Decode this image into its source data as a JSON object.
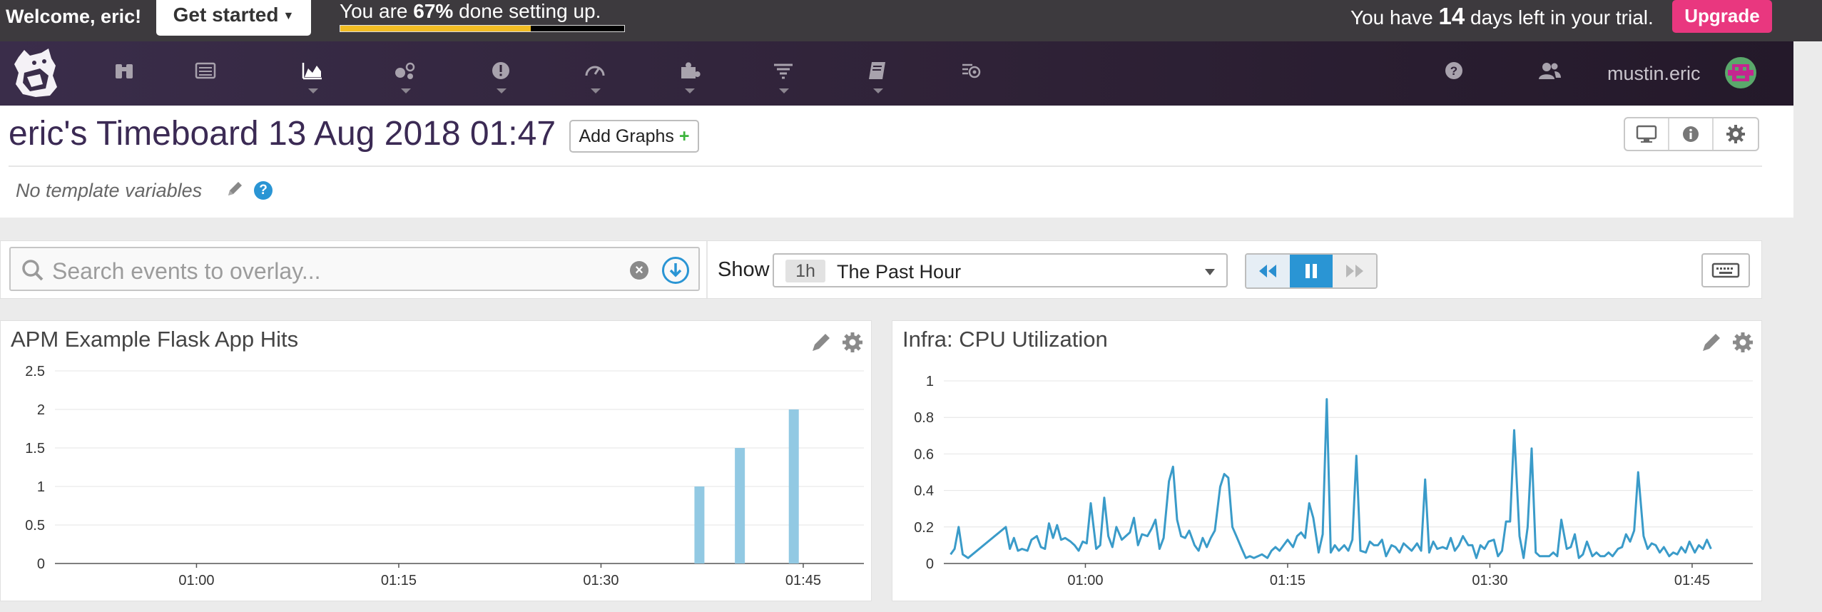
{
  "onboarding": {
    "welcome": "Welcome, eric!",
    "get_started": "Get started",
    "progress_prefix": "You are",
    "progress_percent": "67%",
    "progress_suffix": "done setting up.",
    "progress_value": 0.67,
    "trial_prefix": "You have",
    "trial_days": "14",
    "trial_suffix": "days left in your trial.",
    "upgrade": "Upgrade"
  },
  "nav": {
    "items": [
      {
        "icon": "binoculars-icon"
      },
      {
        "icon": "list-icon"
      },
      {
        "icon": "area-chart-icon",
        "active": true
      },
      {
        "icon": "hexagons-icon"
      },
      {
        "icon": "alert-icon"
      },
      {
        "icon": "gauge-icon"
      },
      {
        "icon": "puzzle-icon"
      },
      {
        "icon": "filter-icon"
      },
      {
        "icon": "notebook-icon"
      },
      {
        "icon": "synthetic-icon"
      }
    ],
    "username": "mustin.eric"
  },
  "board": {
    "title": "eric's Timeboard 13 Aug 2018 01:47",
    "add_graphs": "Add Graphs",
    "add_graphs_plus": "+",
    "template_vars": "No template variables",
    "help_glyph": "?"
  },
  "controls": {
    "search_placeholder": "Search events to overlay...",
    "show_label": "Show",
    "time_badge": "1h",
    "time_text": "The Past Hour"
  },
  "colors": {
    "accent": "#2a95d4",
    "upgrade": "#e9377f",
    "progress": "#f2bd23",
    "bar": "#92c9e3",
    "line": "#3a9bc9"
  },
  "chart_data": [
    {
      "type": "bar",
      "title": "APM Example Flask App Hits",
      "x_ticks": [
        "01:00",
        "01:15",
        "01:30",
        "01:45"
      ],
      "x_tick_minutes": [
        0,
        15,
        30,
        45
      ],
      "xlim_minutes": [
        -10.5,
        49.5
      ],
      "y_ticks": [
        "0",
        "0.5",
        "1",
        "1.5",
        "2",
        "2.5"
      ],
      "ylim": [
        0,
        2.5
      ],
      "bars": [
        {
          "x_minute": 37.3,
          "value": 1
        },
        {
          "x_minute": 40.3,
          "value": 1.5
        },
        {
          "x_minute": 44.3,
          "value": 2
        }
      ]
    },
    {
      "type": "line",
      "title": "Infra: CPU Utilization",
      "x_ticks": [
        "01:00",
        "01:15",
        "01:30",
        "01:45"
      ],
      "x_tick_minutes": [
        0,
        15,
        30,
        45
      ],
      "xlim_minutes": [
        -10.5,
        49.5
      ],
      "y_ticks": [
        "0",
        "0.2",
        "0.4",
        "0.6",
        "0.8",
        "1"
      ],
      "ylim": [
        0,
        1
      ],
      "series": [
        {
          "x_minutes": [
            -10.0,
            -9.7,
            -9.4,
            -9.1,
            -8.7,
            -5.9,
            -5.6,
            -5.3,
            -5.0,
            -4.7,
            -4.3,
            -4.0,
            -3.6,
            -3.3,
            -3.0,
            -2.7,
            -2.4,
            -2.1,
            -1.8,
            -1.5,
            -1.1,
            -0.8,
            -0.5,
            -0.2,
            0.1,
            0.4,
            0.8,
            1.1,
            1.4,
            1.7,
            2.0,
            2.3,
            2.7,
            3.0,
            3.3,
            3.6,
            3.9,
            4.2,
            4.6,
            4.9,
            5.2,
            5.5,
            5.8,
            6.2,
            6.5,
            6.8,
            7.1,
            7.4,
            7.7,
            8.1,
            8.4,
            8.7,
            9.0,
            9.3,
            9.6,
            10.0,
            10.3,
            10.6,
            10.9,
            11.2,
            11.6,
            11.9,
            12.2,
            12.5,
            12.8,
            13.1,
            13.5,
            13.8,
            14.1,
            14.4,
            14.7,
            15.0,
            15.4,
            15.7,
            16.0,
            16.3,
            16.6,
            16.9,
            17.3,
            17.6,
            17.9,
            18.2,
            18.5,
            18.8,
            19.2,
            19.5,
            19.8,
            20.1,
            20.4,
            20.8,
            21.1,
            21.4,
            21.7,
            22.0,
            22.3,
            22.7,
            23.0,
            23.3,
            23.6,
            23.9,
            24.2,
            24.6,
            24.9,
            25.2,
            25.5,
            25.8,
            26.1,
            26.5,
            26.8,
            27.1,
            27.4,
            27.7,
            28.0,
            28.4,
            28.7,
            29.0,
            29.3,
            29.6,
            29.9,
            30.3,
            30.6,
            30.9,
            31.2,
            31.5,
            31.8,
            32.2,
            32.5,
            32.8,
            33.1,
            33.4,
            33.7,
            34.1,
            34.4,
            34.7,
            35.0,
            35.3,
            35.7,
            36.0,
            36.3,
            36.6,
            36.9,
            37.2,
            37.6,
            37.9,
            38.2,
            38.5,
            38.8,
            39.1,
            39.5,
            39.8,
            40.1,
            40.4,
            40.7,
            41.0,
            41.4,
            41.7,
            42.0,
            42.3,
            42.6,
            42.9,
            43.3,
            43.6,
            43.9,
            44.2,
            44.5,
            44.8,
            45.2,
            45.5,
            45.8,
            46.1,
            46.4,
            46.7,
            47.1
          ],
          "values": [
            0.05,
            0.08,
            0.2,
            0.05,
            0.03,
            0.2,
            0.08,
            0.14,
            0.07,
            0.08,
            0.07,
            0.13,
            0.15,
            0.09,
            0.08,
            0.22,
            0.14,
            0.21,
            0.13,
            0.14,
            0.12,
            0.1,
            0.07,
            0.12,
            0.11,
            0.33,
            0.08,
            0.1,
            0.36,
            0.15,
            0.09,
            0.2,
            0.13,
            0.15,
            0.17,
            0.25,
            0.1,
            0.16,
            0.15,
            0.19,
            0.24,
            0.08,
            0.14,
            0.45,
            0.53,
            0.24,
            0.15,
            0.14,
            0.18,
            0.1,
            0.07,
            0.14,
            0.09,
            0.14,
            0.18,
            0.42,
            0.49,
            0.47,
            0.2,
            0.15,
            0.08,
            0.03,
            0.04,
            0.03,
            0.04,
            0.05,
            0.03,
            0.07,
            0.09,
            0.07,
            0.1,
            0.13,
            0.09,
            0.15,
            0.17,
            0.14,
            0.33,
            0.25,
            0.06,
            0.16,
            0.9,
            0.06,
            0.1,
            0.07,
            0.1,
            0.07,
            0.13,
            0.59,
            0.07,
            0.06,
            0.12,
            0.1,
            0.1,
            0.13,
            0.04,
            0.1,
            0.09,
            0.06,
            0.11,
            0.09,
            0.07,
            0.11,
            0.07,
            0.46,
            0.06,
            0.12,
            0.08,
            0.09,
            0.08,
            0.14,
            0.07,
            0.1,
            0.15,
            0.1,
            0.1,
            0.03,
            0.1,
            0.08,
            0.12,
            0.13,
            0.04,
            0.07,
            0.23,
            0.23,
            0.73,
            0.15,
            0.03,
            0.2,
            0.63,
            0.06,
            0.04,
            0.04,
            0.04,
            0.06,
            0.04,
            0.24,
            0.08,
            0.09,
            0.16,
            0.03,
            0.05,
            0.12,
            0.04,
            0.06,
            0.04,
            0.04,
            0.06,
            0.04,
            0.08,
            0.09,
            0.16,
            0.12,
            0.18,
            0.5,
            0.15,
            0.08,
            0.11,
            0.1,
            0.06,
            0.09,
            0.04,
            0.06,
            0.05,
            0.09,
            0.06,
            0.12,
            0.06,
            0.1,
            0.08,
            0.13,
            0.08
          ]
        }
      ]
    }
  ]
}
